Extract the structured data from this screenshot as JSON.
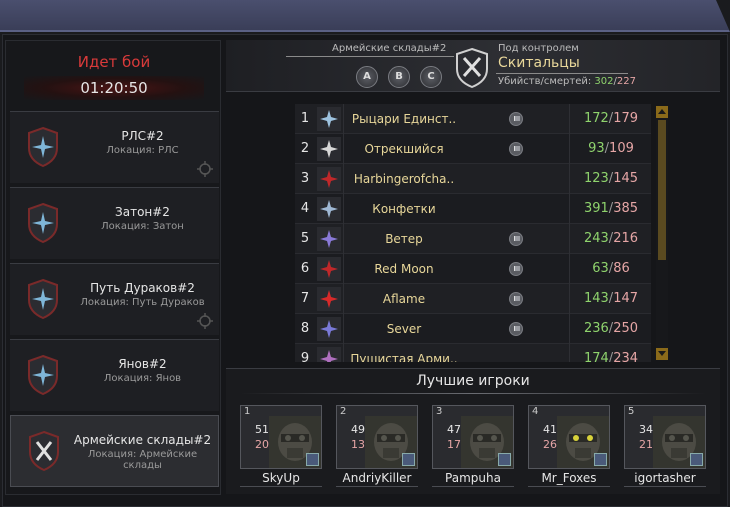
{
  "battle": {
    "title": "Идет бой",
    "timer": "01:20:50"
  },
  "locations": [
    {
      "name": "РЛС#2",
      "sub": "Локация: РЛС",
      "icon": "star-emblem-icon",
      "target": true
    },
    {
      "name": "Затон#2",
      "sub": "Локация: Затон",
      "icon": "star-emblem-icon",
      "target": false
    },
    {
      "name": "Путь Дураков#2",
      "sub": "Локация: Путь Дураков",
      "icon": "star-emblem-icon",
      "target": true
    },
    {
      "name": "Янов#2",
      "sub": "Локация: Янов",
      "icon": "star-emblem-icon",
      "target": false
    },
    {
      "name": "Армейские склады#2",
      "sub": "Локация: Армейские склады",
      "icon": "crossed-swords-icon",
      "active": true
    }
  ],
  "header": {
    "location": "Армейские склады#2",
    "points": [
      "A",
      "B",
      "C"
    ],
    "control_label": "Под контролем",
    "control_name": "Скитальцы",
    "kd_label": "Убийств/смертей:",
    "kills": "302",
    "deaths": "227"
  },
  "groups": [
    {
      "rank": "1",
      "name": "Рыцари Единст..",
      "flag": true,
      "kills": "172",
      "deaths": "179",
      "emblem_color": "#9ec3e0"
    },
    {
      "rank": "2",
      "name": "Отрекшийся",
      "flag": true,
      "kills": "93",
      "deaths": "109",
      "emblem_color": "#d8d8d8"
    },
    {
      "rank": "3",
      "name": "Harbingerofcha..",
      "flag": false,
      "kills": "123",
      "deaths": "145",
      "emblem_color": "#c0282a"
    },
    {
      "rank": "4",
      "name": "Конфетки",
      "flag": false,
      "kills": "391",
      "deaths": "385",
      "emblem_color": "#9fb8d4"
    },
    {
      "rank": "5",
      "name": "Ветер",
      "flag": true,
      "kills": "243",
      "deaths": "216",
      "emblem_color": "#8a7ad8"
    },
    {
      "rank": "6",
      "name": "Red Moon",
      "flag": true,
      "kills": "63",
      "deaths": "86",
      "emblem_color": "#c0282a"
    },
    {
      "rank": "7",
      "name": "Aflame",
      "flag": true,
      "kills": "143",
      "deaths": "147",
      "emblem_color": "#d82a2a"
    },
    {
      "rank": "8",
      "name": "Sever",
      "flag": true,
      "kills": "236",
      "deaths": "250",
      "emblem_color": "#7a7ad8"
    },
    {
      "rank": "9",
      "name": "Пушистая Арми..",
      "flag": false,
      "kills": "174",
      "deaths": "234",
      "emblem_color": "#b070c0"
    }
  ],
  "best": {
    "title": "Лучшие игроки",
    "players": [
      {
        "rank": "1",
        "name": "SkyUp",
        "kills": "51",
        "deaths": "20"
      },
      {
        "rank": "2",
        "name": "AndriyKiller",
        "kills": "49",
        "deaths": "13"
      },
      {
        "rank": "3",
        "name": "Pampuha",
        "kills": "47",
        "deaths": "17"
      },
      {
        "rank": "4",
        "name": "Mr_Foxes",
        "kills": "41",
        "deaths": "26"
      },
      {
        "rank": "5",
        "name": "igortasher",
        "kills": "34",
        "deaths": "21"
      }
    ]
  },
  "colors": {
    "accent_red": "#d93a3a",
    "gold": "#e8d79a",
    "kills": "#8fd36d",
    "deaths": "#e6a6a6"
  }
}
